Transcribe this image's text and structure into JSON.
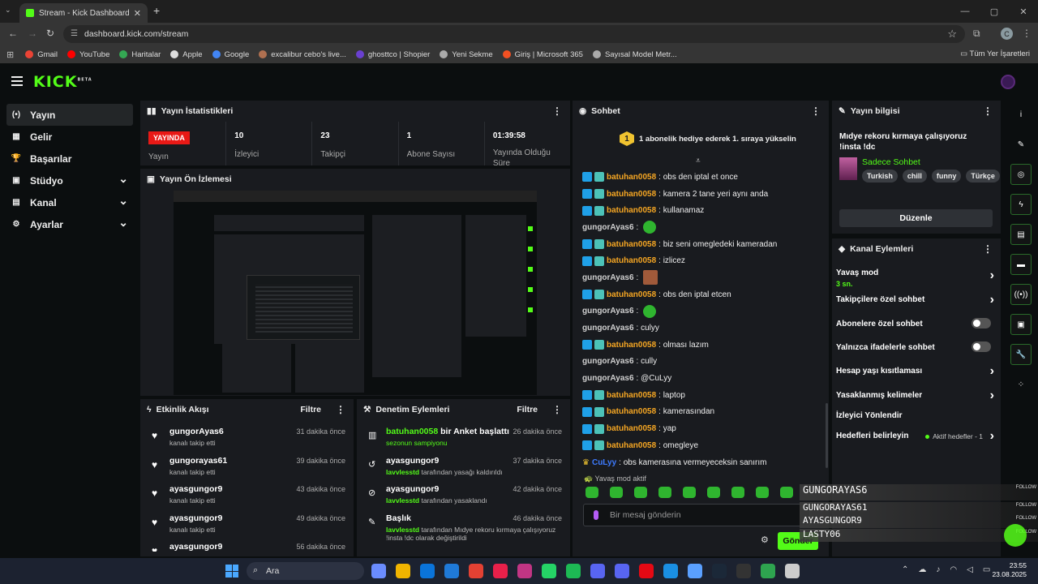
{
  "browser": {
    "tab_title": "Stream - Kick Dashboard",
    "url": "dashboard.kick.com/stream",
    "profile_initial": "C",
    "bookmarks": [
      {
        "label": "Gmail",
        "color": "#ea4335"
      },
      {
        "label": "YouTube",
        "color": "#ff0000"
      },
      {
        "label": "Haritalar",
        "color": "#34a853"
      },
      {
        "label": "Apple",
        "color": "#dddddd"
      },
      {
        "label": "Google",
        "color": "#4285f4"
      },
      {
        "label": "excalibur cebo's live...",
        "color": "#b07050"
      },
      {
        "label": "ghosttco | Shopier",
        "color": "#6a40d0"
      },
      {
        "label": "Yeni Sekme",
        "color": "#aaaaaa"
      },
      {
        "label": "Giriş | Microsoft 365",
        "color": "#f25022"
      },
      {
        "label": "Sayısal Model Metr...",
        "color": "#aaaaaa"
      }
    ],
    "all_bookmarks": "Tüm Yer İşaretleri"
  },
  "brand": {
    "logo": "KICK",
    "beta": "BETA",
    "accent": "#53fc18"
  },
  "sidebar": {
    "items": [
      {
        "label": "Yayın",
        "icon": "broadcast-icon",
        "glyph": "(•)",
        "has_chevron": false
      },
      {
        "label": "Gelir",
        "icon": "wallet-icon",
        "glyph": "▦",
        "has_chevron": false
      },
      {
        "label": "Başarılar",
        "icon": "trophy-icon",
        "glyph": "🏆",
        "has_chevron": false
      },
      {
        "label": "Stüdyo",
        "icon": "studio-icon",
        "glyph": "▣",
        "has_chevron": true
      },
      {
        "label": "Kanal",
        "icon": "channel-icon",
        "glyph": "▤",
        "has_chevron": true
      },
      {
        "label": "Ayarlar",
        "icon": "gear-icon",
        "glyph": "⚙",
        "has_chevron": true
      }
    ]
  },
  "stats": {
    "title": "Yayın İstatistikleri",
    "live_badge": "YAYINDA",
    "live_label": "Yayın",
    "items": [
      {
        "value": "10",
        "label": "İzleyici"
      },
      {
        "value": "23",
        "label": "Takipçi"
      },
      {
        "value": "1",
        "label": "Abone Sayısı"
      },
      {
        "value": "01:39:58",
        "label": "Yayında Olduğu Süre"
      }
    ]
  },
  "preview": {
    "title": "Yayın Ön İzlemesi"
  },
  "activity": {
    "title": "Etkinlik Akışı",
    "filter": "Filtre",
    "items": [
      {
        "name": "gungorAyas6",
        "sub": "kanalı takip etti",
        "time": "31 dakika önce"
      },
      {
        "name": "gungorayas61",
        "sub": "kanalı takip etti",
        "time": "39 dakika önce"
      },
      {
        "name": "ayasgungor9",
        "sub": "kanalı takip etti",
        "time": "43 dakika önce"
      },
      {
        "name": "ayasgungor9",
        "sub": "kanalı takip etti",
        "time": "49 dakika önce"
      },
      {
        "name": "ayasgungor9",
        "sub": "",
        "time": "56 dakika önce"
      }
    ]
  },
  "moderation": {
    "title": "Denetim Eylemleri",
    "filter": "Filtre",
    "items": [
      {
        "name": "batuhan0058",
        "name_after": " bir Anket başlattı",
        "sub_user": "",
        "sub": "sezonun sampiyonu",
        "time": "26 dakika önce",
        "icon": "poll-icon",
        "glyph": "▥"
      },
      {
        "name": "ayasgungor9",
        "name_after": "",
        "sub_user": "lavvlesstd",
        "sub": " tarafından yasağı kaldırıldı",
        "time": "37 dakika önce",
        "icon": "unban-icon",
        "glyph": "↺"
      },
      {
        "name": "ayasgungor9",
        "name_after": "",
        "sub_user": "lavvlesstd",
        "sub": " tarafından yasaklandı",
        "time": "42 dakika önce",
        "icon": "ban-icon",
        "glyph": "⊘"
      },
      {
        "name": "Başlık",
        "name_after": "",
        "sub_user": "lavvlesstd",
        "sub": " tarafından Mıdye rekoru kırmaya çalışıyoruz !insta !dc olarak değiştirildi",
        "time": "46 dakika önce",
        "icon": "title-icon",
        "glyph": "✎"
      }
    ]
  },
  "chat": {
    "title": "Sohbet",
    "pinned": "1 abonelik hediye ederek 1. sıraya yükselin",
    "pinned_rank": "1",
    "messages": [
      {
        "user": "batuhan0058",
        "badges": true,
        "text": ": obs den iptal et once",
        "emote": ""
      },
      {
        "user": "batuhan0058",
        "badges": true,
        "text": ": kamera 2 tane yeri aynı anda",
        "emote": ""
      },
      {
        "user": "batuhan0058",
        "badges": true,
        "text": ": kullanamaz",
        "emote": ""
      },
      {
        "user": "gungorAyas6",
        "badges": false,
        "text": ":",
        "emote": "green"
      },
      {
        "user": "batuhan0058",
        "badges": true,
        "text": ": biz seni omegledeki kameradan",
        "emote": ""
      },
      {
        "user": "batuhan0058",
        "badges": true,
        "text": ": izlicez",
        "emote": ""
      },
      {
        "user": "gungorAyas6",
        "badges": false,
        "text": ":",
        "emote": "img"
      },
      {
        "user": "batuhan0058",
        "badges": true,
        "text": ": obs den iptal etcen",
        "emote": ""
      },
      {
        "user": "gungorAyas6",
        "badges": false,
        "text": ":",
        "emote": "green"
      },
      {
        "user": "gungorAyas6",
        "badges": false,
        "text": ": culyy",
        "emote": ""
      },
      {
        "user": "batuhan0058",
        "badges": true,
        "text": ": olması lazım",
        "emote": ""
      },
      {
        "user": "gungorAyas6",
        "badges": false,
        "text": ": cully",
        "emote": ""
      },
      {
        "user": "gungorAyas6",
        "badges": false,
        "text": ": @CuLyy",
        "emote": ""
      },
      {
        "user": "batuhan0058",
        "badges": true,
        "text": ": laptop",
        "emote": ""
      },
      {
        "user": "batuhan0058",
        "badges": true,
        "text": ": kamerasından",
        "emote": ""
      },
      {
        "user": "batuhan0058",
        "badges": true,
        "text": ": yap",
        "emote": ""
      },
      {
        "user": "batuhan0058",
        "badges": true,
        "text": ": omegleye",
        "emote": ""
      },
      {
        "user": "CuLyy",
        "badges": false,
        "crown": true,
        "text": ": obs kamerasına vermeyeceksin sanırım",
        "emote": ""
      }
    ],
    "slow_mode": "Yavaş mod aktif",
    "input_placeholder": "Bir mesaj gönderin",
    "send": "Gönder",
    "colors": {
      "batuhan0058": "#f5a623",
      "gungorAyas6": "#d0d0d0",
      "CuLyy": "#3d7bff"
    }
  },
  "stream_info": {
    "title_label": "Yayın bilgisi",
    "title": "Mıdye rekoru kırmaya çalışıyoruz !insta !dc",
    "category": "Sadece Sohbet",
    "tags": [
      "Turkish",
      "chill",
      "funny",
      "Türkçe"
    ],
    "edit": "Düzenle"
  },
  "channel_actions": {
    "title": "Kanal Eylemleri",
    "items": [
      {
        "label": "Yavaş mod",
        "sub": "3 sn.",
        "kind": "arrow"
      },
      {
        "label": "Takipçilere özel sohbet",
        "sub": "",
        "kind": "arrow"
      },
      {
        "label": "Abonelere özel sohbet",
        "sub": "",
        "kind": "toggle"
      },
      {
        "label": "Yalnızca ifadelerle sohbet",
        "sub": "",
        "kind": "toggle"
      },
      {
        "label": "Hesap yaşı kısıtlaması",
        "sub": "",
        "kind": "arrow"
      },
      {
        "label": "Yasaklanmış kelimeler",
        "sub": "",
        "kind": "arrow"
      },
      {
        "label": "İzleyici Yönlendir",
        "sub": "",
        "kind": "none"
      },
      {
        "label": "Hedefleri belirleyin",
        "sub": "",
        "kind": "arrow",
        "extra": "Aktif hedefler - 1"
      }
    ]
  },
  "rail": [
    {
      "icon": "info-icon",
      "glyph": "i",
      "plain": true
    },
    {
      "icon": "pencil-icon",
      "glyph": "✎",
      "plain": true
    },
    {
      "icon": "target-icon",
      "glyph": "◎",
      "plain": false
    },
    {
      "icon": "bolt-icon",
      "glyph": "ϟ",
      "plain": false
    },
    {
      "icon": "clipboard-icon",
      "glyph": "▤",
      "plain": false
    },
    {
      "icon": "chat-icon",
      "glyph": "▬",
      "plain": false
    },
    {
      "icon": "broadcast-icon",
      "glyph": "((•))",
      "plain": false
    },
    {
      "icon": "id-card-icon",
      "glyph": "▣",
      "plain": false
    },
    {
      "icon": "wrench-icon",
      "glyph": "🔧",
      "plain": false
    },
    {
      "icon": "dots-icon",
      "glyph": "⁘",
      "plain": true
    }
  ],
  "overlay": {
    "follow": "FOLLOW",
    "names": [
      "GUNGORAYAS6",
      "GUNGORAYAS61",
      "AYASGUNGOR9",
      "LASTY06"
    ]
  },
  "taskbar": {
    "search": "Ara",
    "time": "23:55",
    "date": "23.08.2025",
    "app_colors": [
      "#6a8cff",
      "#f0b400",
      "#0a74da",
      "#1f7ad8",
      "#e34133",
      "#e8204a",
      "#c13584",
      "#25d366",
      "#1db954",
      "#5865f2",
      "#5865f2",
      "#e50914",
      "#1a8fe3",
      "#5aa0ff",
      "#1b2838",
      "#333333",
      "#2ea44f",
      "#cccccc"
    ]
  }
}
